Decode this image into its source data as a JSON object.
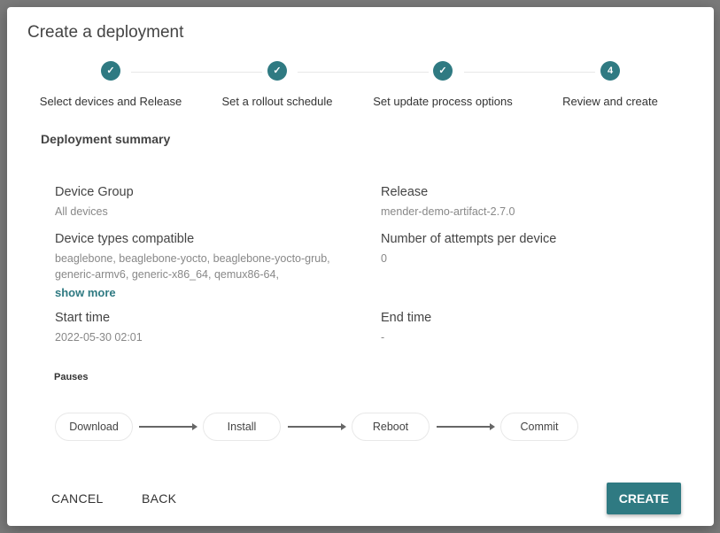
{
  "dialog": {
    "title": "Create a deployment"
  },
  "steps": [
    {
      "label": "Select devices and Release",
      "state": "complete",
      "icon": "check-icon"
    },
    {
      "label": "Set a rollout schedule",
      "state": "complete",
      "icon": "check-icon"
    },
    {
      "label": "Set update process options",
      "state": "complete",
      "icon": "check-icon"
    },
    {
      "label": "Review and create",
      "state": "active",
      "number": "4"
    }
  ],
  "summary": {
    "heading": "Deployment summary",
    "device_group": {
      "label": "Device Group",
      "value": "All devices"
    },
    "release": {
      "label": "Release",
      "value": "mender-demo-artifact-2.7.0"
    },
    "device_types": {
      "label": "Device types compatible",
      "value": "beaglebone, beaglebone-yocto, beaglebone-yocto-grub, generic-armv6, generic-x86_64, qemux86-64,",
      "show_more": "show more"
    },
    "attempts": {
      "label": "Number of attempts per device",
      "value": "0"
    },
    "start": {
      "label": "Start time",
      "value": "2022-05-30 02:01"
    },
    "end": {
      "label": "End time",
      "value": "-"
    }
  },
  "pauses": {
    "label": "Pauses",
    "steps": [
      "Download",
      "Install",
      "Reboot",
      "Commit"
    ]
  },
  "buttons": {
    "cancel": "CANCEL",
    "back": "BACK",
    "create": "CREATE"
  },
  "colors": {
    "accent": "#2f7a82"
  }
}
